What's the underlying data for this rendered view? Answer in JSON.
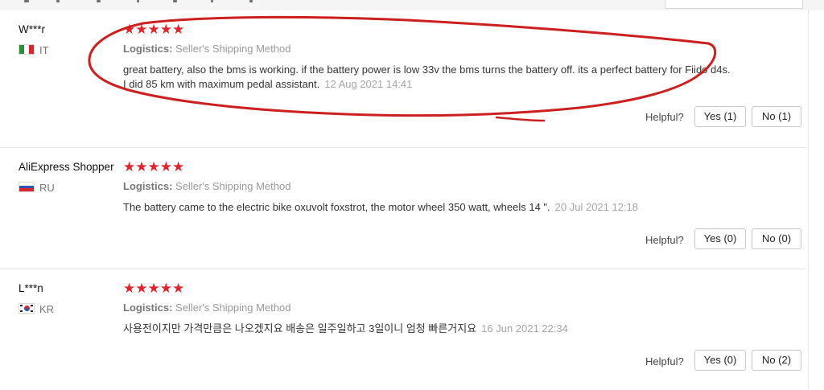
{
  "colors": {
    "star": "#e0242d",
    "annotation": "#cc1f1f",
    "divider": "#e6e6e6"
  },
  "reviews": [
    {
      "user": "W***r",
      "country": "IT",
      "flag_icon": "italy-flag-icon",
      "stars": "★★★★★",
      "logistics_label": "Logistics:",
      "logistics_value": "Seller's Shipping Method",
      "text": "great battery, also the bms is working. if the battery power is low 33v the bms turns the battery off. its a perfect battery for Fiido d4s. I did 85 km with maximum pedal assistant.",
      "date": "12 Aug 2021 14:41",
      "helpful_label": "Helpful?",
      "yes_label": "Yes (1)",
      "no_label": "No (1)"
    },
    {
      "user": "AliExpress Shopper",
      "country": "RU",
      "flag_icon": "russia-flag-icon",
      "stars": "★★★★★",
      "logistics_label": "Logistics:",
      "logistics_value": "Seller's Shipping Method",
      "text": "The battery came to the electric bike oxuvolt foxstrot, the motor wheel 350 watt, wheels 14 \".",
      "date": "20 Jul 2021 12:18",
      "helpful_label": "Helpful?",
      "yes_label": "Yes (0)",
      "no_label": "No (0)"
    },
    {
      "user": "L***n",
      "country": "KR",
      "flag_icon": "korea-flag-icon",
      "stars": "★★★★★",
      "logistics_label": "Logistics:",
      "logistics_value": "Seller's Shipping Method",
      "text": "사용전이지만 가격만큼은 나오겠지요 배송은 일주일하고 3일이니 엄청 빠른거지요",
      "date": "16 Jun 2021 22:34",
      "helpful_label": "Helpful?",
      "yes_label": "Yes (0)",
      "no_label": "No (2)"
    }
  ]
}
